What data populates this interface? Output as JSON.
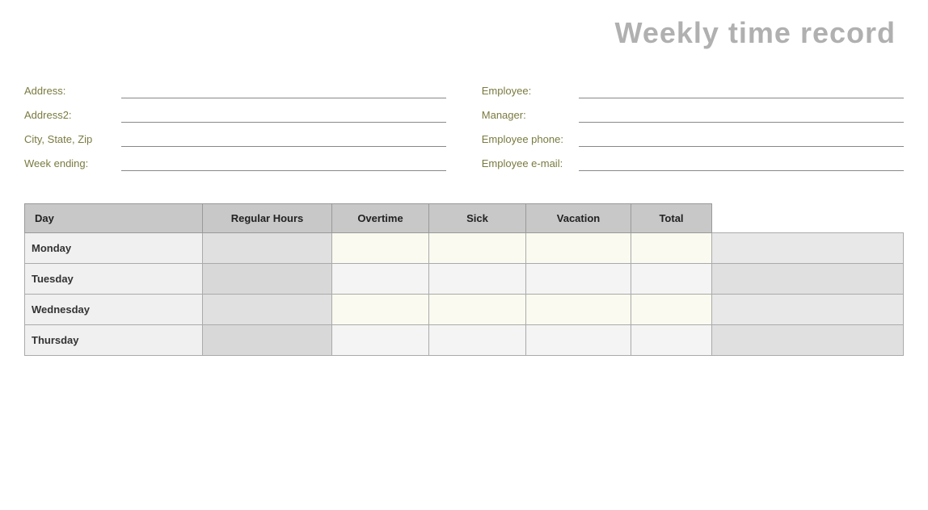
{
  "title": "Weekly time record",
  "form": {
    "left": {
      "address_label": "Address:",
      "address2_label": "Address2:",
      "city_label": "City, State, Zip",
      "week_ending_label": "Week ending:"
    },
    "right": {
      "employee_label": "Employee:",
      "manager_label": "Manager:",
      "phone_label": "Employee phone:",
      "email_label": "Employee e-mail:"
    }
  },
  "table": {
    "headers": {
      "day": "Day",
      "regular": "Regular Hours",
      "overtime": "Overtime",
      "sick": "Sick",
      "vacation": "Vacation",
      "total": "Total"
    },
    "rows": [
      {
        "day": "Monday"
      },
      {
        "day": "Tuesday"
      },
      {
        "day": "Wednesday"
      },
      {
        "day": "Thursday"
      }
    ]
  }
}
